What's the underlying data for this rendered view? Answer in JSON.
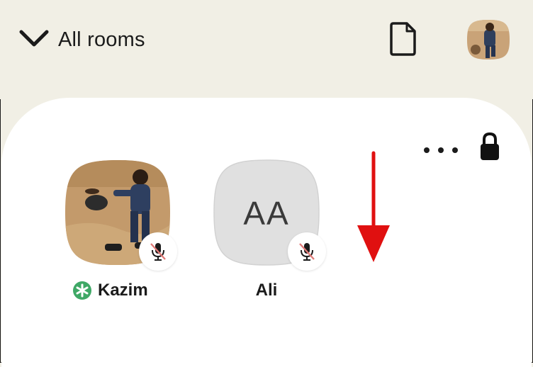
{
  "header": {
    "rooms_toggle_label": "All rooms",
    "icons": [
      "chevron-down-icon",
      "document-icon",
      "user-avatar"
    ]
  },
  "room": {
    "icons": [
      "more-icon",
      "lock-icon"
    ],
    "participants": [
      {
        "name": "Kazim",
        "avatar": "photo",
        "role_icon": "moderator-asterisk-icon",
        "muted": true
      },
      {
        "name": "Ali",
        "avatar_initials": "AA",
        "muted": true
      }
    ]
  },
  "annotation": {
    "type": "scroll-down-arrow",
    "color": "#e01010"
  },
  "colors": {
    "header_bg": "#f1efe5",
    "panel_bg": "#ffffff",
    "moderator_green": "#3fa866",
    "muted_slash": "#e07a78",
    "initials_tile": "#e0e0e0"
  }
}
